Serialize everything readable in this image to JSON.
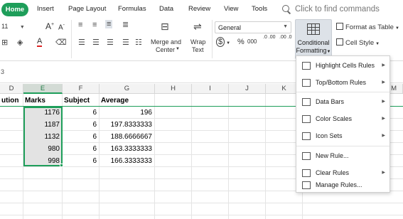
{
  "menubar": {
    "home": "Home",
    "items": [
      "Insert",
      "Page Layout",
      "Formulas",
      "Data",
      "Review",
      "View",
      "Tools"
    ],
    "search_placeholder": "Click to find commands"
  },
  "ribbon": {
    "font_size": "11",
    "font_size_up": "A",
    "font_size_down": "A",
    "font_color_glyph": "A",
    "number_format": "General",
    "merge_label_1": "Merge and",
    "merge_label_2": "Center",
    "wrap_label_1": "Wrap",
    "wrap_label_2": "Text",
    "currency_glyph": "$",
    "percent_glyph": "%",
    "thousands_glyph": "000",
    "dec_increase_glyph": ".0 .00",
    "dec_decrease_glyph": ".00 .0",
    "conditional_label_1": "Conditional",
    "conditional_label_2": "Formatting",
    "format_as_table": "Format as Table",
    "cell_style": "Cell Style"
  },
  "formula_bar": {
    "fragment": "3"
  },
  "grid": {
    "columns": [
      "D",
      "E",
      "F",
      "G",
      "H",
      "I",
      "J",
      "K",
      "M"
    ],
    "selected_column": "E",
    "partial_header": "ution",
    "headers": {
      "marks": "Marks",
      "subject": "Subject",
      "average": "Average"
    },
    "rows": [
      {
        "marks": "1176",
        "subject": "6",
        "average": "196"
      },
      {
        "marks": "1187",
        "subject": "6",
        "average": "197.8333333"
      },
      {
        "marks": "1132",
        "subject": "6",
        "average": "188.6666667"
      },
      {
        "marks": "980",
        "subject": "6",
        "average": "163.3333333"
      },
      {
        "marks": "998",
        "subject": "6",
        "average": "166.3333333"
      }
    ]
  },
  "conditional_menu": {
    "items": [
      {
        "label": "Highlight Cells Rules",
        "submenu": true,
        "icon": "highlight-rules-icon"
      },
      {
        "label": "Top/Bottom Rules",
        "submenu": true,
        "icon": "top-bottom-icon"
      },
      {
        "label": "Data Bars",
        "submenu": true,
        "icon": "data-bars-icon"
      },
      {
        "label": "Color Scales",
        "submenu": true,
        "icon": "color-scales-icon"
      },
      {
        "label": "Icon Sets",
        "submenu": true,
        "icon": "icon-sets-icon"
      },
      {
        "label": "New Rule...",
        "submenu": false,
        "icon": "new-rule-icon"
      },
      {
        "label": "Clear Rules",
        "submenu": true,
        "icon": "clear-rules-icon"
      },
      {
        "label": "Manage Rules...",
        "submenu": false,
        "icon": "manage-rules-icon"
      }
    ],
    "submenu_arrow": "▶"
  },
  "colors": {
    "accent": "#1e9e5a",
    "selection_fill": "#e7e7e7",
    "button_active": "#dde2e8"
  }
}
